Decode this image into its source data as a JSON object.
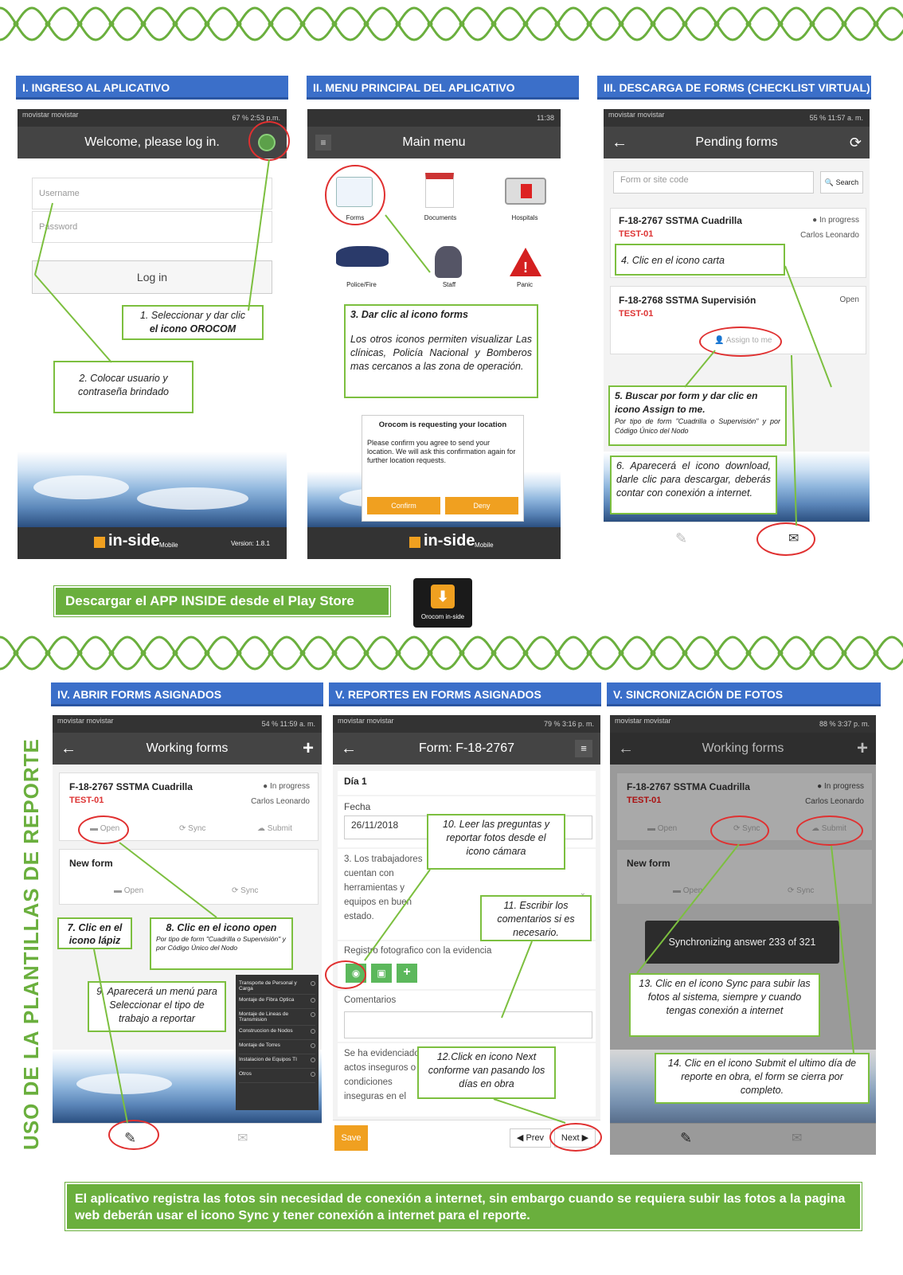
{
  "section1": {
    "header": "I. INGRESO AL APLICATIVO",
    "status_left": "movistar movistar",
    "status_right": "67 % 2:53 p.m.",
    "appbar_title": "Welcome, please log in.",
    "username_placeholder": "Username",
    "password_placeholder": "Password",
    "login_button": "Log in",
    "footer_brand": "in-side",
    "footer_brand_sub": "Mobile",
    "footer_version": "Version: 1.8.1",
    "annot1_a": "1. Seleccionar y dar clic",
    "annot1_b": "el icono OROCOM",
    "annot2": "2. Colocar usuario y contraseña brindado"
  },
  "section2": {
    "header": "II. MENU PRINCIPAL DEL APLICATIVO",
    "status_right": "11:38",
    "appbar_title": "Main menu",
    "menu": [
      "Forms",
      "Documents",
      "Hospitals",
      "Police/Fire",
      "Staff",
      "Panic"
    ],
    "annot3_title": "3. Dar clic al icono forms",
    "annot3_body": "Los otros iconos permiten visualizar Las clínicas, Policía Nacional y Bomberos mas cercanos a las zona de operación.",
    "dialog_title": "Orocom is requesting your location",
    "dialog_body": "Please confirm you agree to send your location. We will ask this confirmation again for further location requests.",
    "dialog_confirm": "Confirm",
    "dialog_deny": "Deny",
    "footer_brand": "in-side",
    "footer_brand_sub": "Mobile"
  },
  "section3": {
    "header": "III. DESCARGA DE FORMS (CHECKLIST VIRTUAL)",
    "status_left": "movistar movistar",
    "status_right": "55 % 11:57 a. m.",
    "appbar_title": "Pending forms",
    "search_placeholder": "Form or site code",
    "search_button": "Search",
    "card1_title": "F-18-2767 SSTMA Cuadrilla",
    "card1_code": "TEST-01",
    "card1_status": "In progress",
    "card1_user": "Carlos Leonardo",
    "card2_title": "F-18-2768 SSTMA Supervisión",
    "card2_code": "TEST-01",
    "card2_status": "Open",
    "card2_assign": "Assign to me",
    "annot4": "4. Clic en el icono carta",
    "annot5_title": "5. Buscar por form y dar clic en icono Assign to me.",
    "annot5_body": "Por tipo de form \"Cuadrilla o Supervisión\" y por Código Único del Nodo",
    "annot6": "6. Aparecerá el icono download, darle clic para descargar, deberás contar con conexión a internet."
  },
  "download_bar": {
    "text": "Descargar el APP INSIDE desde el Play Store",
    "icon_label": "Orocom in-side"
  },
  "section4": {
    "header": "IV. ABRIR FORMS ASIGNADOS",
    "status_left": "movistar movistar",
    "status_right": "54 % 11:59 a. m.",
    "appbar_title": "Working forms",
    "card1_title": "F-18-2767 SSTMA Cuadrilla",
    "card1_code": "TEST-01",
    "card1_status": "In progress",
    "card1_user": "Carlos Leonardo",
    "card1_open": "Open",
    "card1_sync": "Sync",
    "card1_submit": "Submit",
    "card2_title": "New form",
    "card2_open": "Open",
    "card2_sync": "Sync",
    "annot7": "7. Clic en el icono lápiz",
    "annot8_title": "8. Clic en el icono open",
    "annot8_body": "Por tipo de form \"Cuadrilla o Supervisión\" y por Código Único del Nodo",
    "annot9": "9. Aparecerá un menú para Seleccionar el tipo de trabajo a reportar",
    "menu_options": [
      "Transporte de Personal y Carga",
      "Montaje de Fibra Optica",
      "Montaje de Lineas de Transmision",
      "Construccion de Nodos",
      "Montaje de Torres",
      "Instalacion de Equipos TI",
      "Otros"
    ]
  },
  "section5": {
    "header": "V. REPORTES EN FORMS ASIGNADOS",
    "status_left": "movistar movistar",
    "status_right": "79 % 3:16 p. m.",
    "appbar_title": "Form: F-18-2767",
    "day": "Día 1",
    "date_label": "Fecha",
    "date_value": "26/11/2018",
    "q3": "3. Los trabajadores cuentan con herramientas y equipos en buen estado.",
    "photo_label": "Registro fotografico con la evidencia",
    "comments_label": "Comentarios",
    "q4": "Se ha evidenciado actos inseguros o condiciones inseguras en el",
    "save": "Save",
    "prev": "Prev",
    "next": "Next",
    "annot10": "10. Leer las preguntas y reportar fotos desde el icono cámara",
    "annot11": "11. Escribir los comentarios si es necesario.",
    "annot12": "12.Click en icono Next conforme van pasando los días en obra"
  },
  "section6": {
    "header": "V. SINCRONIZACIÓN DE FOTOS",
    "status_left": "movistar movistar",
    "status_right": "88 % 3:37 p. m.",
    "appbar_title": "Working forms",
    "card1_title": "F-18-2767 SSTMA Cuadrilla",
    "card1_code": "TEST-01",
    "card1_status": "In progress",
    "card1_user": "Carlos Leonardo",
    "card1_open": "Open",
    "card1_sync": "Sync",
    "card1_submit": "Submit",
    "card2_title": "New form",
    "card2_open": "Open",
    "card2_sync": "Sync",
    "toast": "Synchronizing answer 233 of 321",
    "annot13": "13. Clic en el icono Sync para subir las fotos al sistema, siempre y cuando tengas conexión a internet",
    "annot14": "14. Clic en el icono Submit el ultimo día de reporte en obra, el form se cierra por completo."
  },
  "side_title": "USO DE LA PLANTILLAS DE REPORTE",
  "bottom_note": "El aplicativo registra las fotos sin necesidad de conexión a internet, sin embargo cuando se requiera subir las fotos a la pagina web deberán usar el icono Sync y tener conexión a internet para el reporte.",
  "colors": {
    "green": "#6aaf3d",
    "blue": "#3b6fc9",
    "red": "#e03030",
    "appbar": "#444444"
  }
}
